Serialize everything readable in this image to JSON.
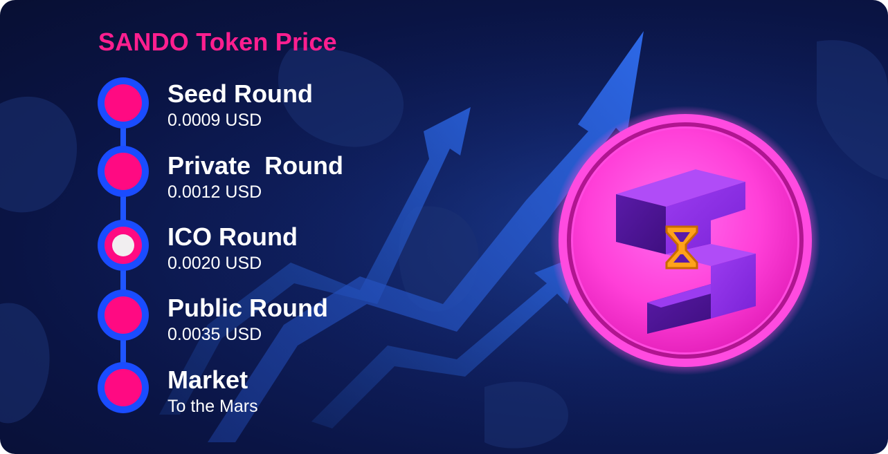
{
  "title": "SANDO Token Price",
  "colors": {
    "accent": "#ff1f8f",
    "timeline_blue": "#1a4cff",
    "dot_pink": "#ff0a82",
    "background": "#0a1444"
  },
  "steps": [
    {
      "name": "Seed Round",
      "value": "0.0009 USD",
      "active": false
    },
    {
      "name": "Private  Round",
      "value": "0.0012 USD",
      "active": false
    },
    {
      "name": "ICO Round",
      "value": "0.0020 USD",
      "active": true
    },
    {
      "name": "Public Round",
      "value": "0.0035 USD",
      "active": false
    },
    {
      "name": "Market",
      "value": "To the Mars",
      "active": false
    }
  ],
  "logo": {
    "icon": "sando-coin-logo"
  }
}
